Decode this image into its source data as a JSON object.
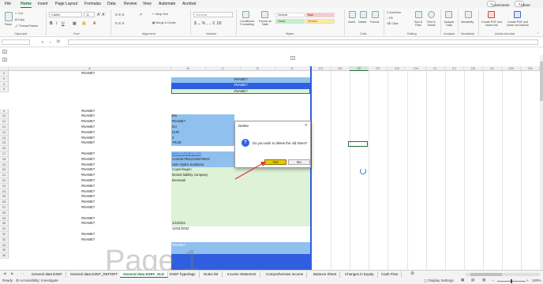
{
  "menu": {
    "items": [
      "File",
      "Home",
      "Insert",
      "Page Layout",
      "Formulas",
      "Data",
      "Review",
      "View",
      "Automate",
      "Acrobat"
    ],
    "active": "Home",
    "comments_label": "Comments",
    "share_label": "Share"
  },
  "ribbon": {
    "groups": {
      "clipboard": "Clipboard",
      "font": "Font",
      "alignment": "Alignment",
      "number": "Number",
      "styles": "Styles",
      "cells": "Cells",
      "editing": "Editing",
      "analysis": "Analysis",
      "sensitivity": "Sensitivity",
      "adobe": "Adobe Acrobat"
    },
    "paste_label": "Paste",
    "cut_label": "Cut",
    "copy_label": "Copy",
    "format_painter_label": "Format Painter",
    "font_name": "Calibri",
    "font_size": "11",
    "wrap_text_label": "Wrap Text",
    "merge_label": "Merge & Center",
    "number_format": "General",
    "conditional_label": "Conditional Formatting",
    "format_table_label": "Format as Table",
    "style_normal": "Normal",
    "style_bad": "Bad",
    "style_good": "Good",
    "style_neutral": "Neutral",
    "insert_label": "Insert",
    "delete_label": "Delete",
    "format_label": "Format",
    "autosum_label": "AutoSum",
    "fill_label": "Fill",
    "clear_label": "Clear",
    "sort_label": "Sort & Filter",
    "find_label": "Find & Select",
    "analyze_label": "Analyze Data",
    "sensitivity_label": "Sensitivity",
    "pdf_label": "Create PDF and share link",
    "pdf_outlook_label": "Create PDF and share via Outlook"
  },
  "formula_bar": {
    "name_box": "",
    "fx": "fx",
    "value": ""
  },
  "columns": {
    "left": [
      "A",
      "B",
      "C",
      "D",
      "E"
    ],
    "right": [
      "CC",
      "CD",
      "CE",
      "CF",
      "CG",
      "CH",
      "CI",
      "CJ",
      "CK",
      "CL",
      "CM",
      "CN"
    ],
    "selected": "CE"
  },
  "rows": [
    "2",
    "3",
    "4",
    "5",
    "9",
    "10",
    "11",
    "12",
    "13",
    "14",
    "15",
    "16",
    "17",
    "18",
    "19",
    "20",
    "21",
    "22",
    "23",
    "24",
    "25",
    "26",
    "27",
    "28",
    "29",
    "30",
    "31",
    "32",
    "33",
    "34",
    "35",
    "36"
  ],
  "cells": {
    "a_values": [
      "#NAME?",
      "#NAME?",
      "#NAME?",
      "#NAME?",
      "#NAME?",
      "#NAME?",
      "#NAME?",
      "#NAME?",
      "#NAME?",
      "#NAME?",
      "#NAME?",
      "#NAME?",
      "#NAME?",
      "#NAME?",
      "#NAME?",
      "#NAME?",
      "#NAME?",
      "#NAME?",
      "#NAME?",
      "#NAME?",
      "#NAME?",
      "#NAME?",
      "#NAME?"
    ],
    "header_bar_1": "#NAME?",
    "header_bar_2": "#NAME?",
    "header_bar_3": "#NAME?",
    "b_values": [
      "EN",
      "#NAME?",
      "EU",
      "EUR",
      "3",
      "TRUE",
      "www.company.com",
      "12345678912345678912",
      "Vam Hydro Solutions",
      "Copenhagen",
      "limited liability company",
      "Denmark",
      "1/1/2022",
      "12/31/2022",
      "#NAME?",
      "#NAME?",
      "#NAME?"
    ]
  },
  "watermark": "Page 1",
  "dialog": {
    "title": "Delete",
    "message": "Do you wish to delete the old sheet?",
    "yes_label": "Yes",
    "no_label": "No"
  },
  "sheet_tabs": [
    "General data ESEF",
    "General data ESEF_REPORT",
    "General data ESEF_OLD",
    "ESEF hyperlags",
    "Notes list",
    "Income Statement",
    "Comprehensive income",
    "Balance Sheet",
    "Changes in Equity",
    "Cash Flow"
  ],
  "active_tab": "General data ESEF_OLD",
  "status": {
    "ready": "Ready",
    "accessibility": "Accessibility: Investigate",
    "display": "Display Settings",
    "zoom": "100%"
  },
  "colors": {
    "accent": "#1e6e3e",
    "blue_dark": "#2f5fe0",
    "blue_light": "#8fc0ee",
    "green_light": "#ddf2d6",
    "arrow": "#d63a3a"
  }
}
